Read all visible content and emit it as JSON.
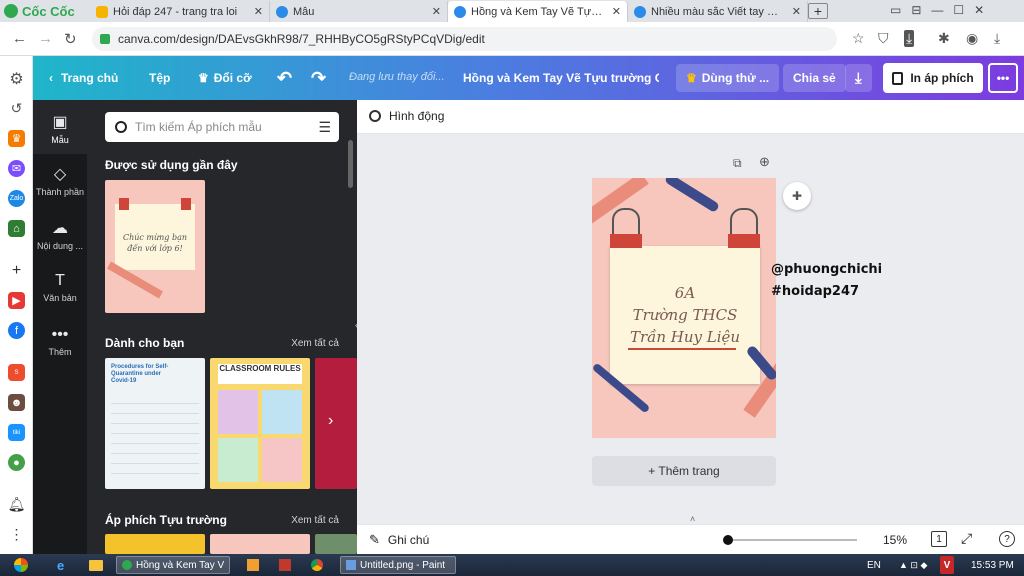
{
  "browser": {
    "brand": "Cốc Cốc",
    "tabs": [
      {
        "title": "Hỏi đáp 247 - trang tra loi",
        "color": "#f4b400"
      },
      {
        "title": "Mẫu",
        "color": "#2b8be8"
      },
      {
        "title": "Hồng và Kem Tay Vẽ Tựu trường",
        "color": "#2b8be8"
      },
      {
        "title": "Nhiều màu sắc Viết tay Giới thiệu",
        "color": "#2b8be8"
      }
    ],
    "url": "canva.com/design/DAEvsGkhR98/7_RHHByCO5gRStyPCqVDig/edit"
  },
  "header": {
    "home": "Trang chủ",
    "file": "Tệp",
    "resize": "Đổi cỡ",
    "saving": "Đang lưu thay đổi...",
    "title": "Hồng và Kem Tay Vẽ Tựu trường Cử...",
    "trial": "Dùng thử ...",
    "share": "Chia sẻ",
    "print": "In áp phích",
    "more": "•••"
  },
  "rail": [
    {
      "label": "Mẫu",
      "icon": "▣"
    },
    {
      "label": "Thành phần",
      "icon": "◇"
    },
    {
      "label": "Nội dung ...",
      "icon": "☁"
    },
    {
      "label": "Văn bản",
      "icon": "T"
    },
    {
      "label": "Thêm",
      "icon": "•••"
    }
  ],
  "panel": {
    "search_placeholder": "Tìm kiếm Áp phích mẫu",
    "recent": "Được sử dụng gần đây",
    "recent_thumb_text": "Chúc mừng bạn đến với lớp 6!",
    "for_you": "Dành cho bạn",
    "see_all": "Xem tất cả",
    "classroom_title": "CLASSROOM RULES",
    "covid_title": "Procedures for Self-Quarantine under Covid-19",
    "posters": "Áp phích Tựu trường",
    "see_all_2": "Xem tất cả"
  },
  "editor": {
    "animate": "Hình động",
    "design_lines": [
      "6A",
      "Trường THCS",
      "Trần Huy Liệu"
    ],
    "watermark_1": "@phuongchichi",
    "watermark_2": "#hoidap247",
    "add_page": "+ Thêm trang",
    "notes": "Ghi chú",
    "zoom": "15%",
    "page_num": "1",
    "help": "?"
  },
  "taskbar": {
    "apps": [
      {
        "label": "Hồng và Kem Tay Vẽ..."
      },
      {
        "label": "Untitled.png - Paint"
      }
    ],
    "lang": "EN",
    "time": "15:53 PM"
  }
}
